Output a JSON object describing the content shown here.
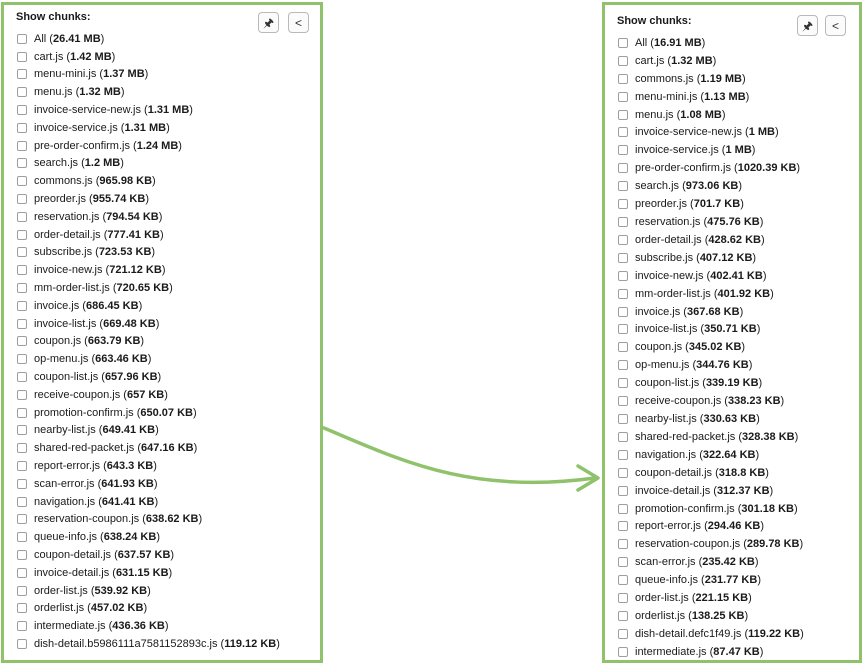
{
  "left_panel": {
    "title": "Show chunks:",
    "pin_icon": "pin-icon",
    "collapse_icon": "chevron-left-icon",
    "items": [
      {
        "name": "All",
        "size": "26.41 MB"
      },
      {
        "name": "cart.js",
        "size": "1.42 MB"
      },
      {
        "name": "menu-mini.js",
        "size": "1.37 MB"
      },
      {
        "name": "menu.js",
        "size": "1.32 MB"
      },
      {
        "name": "invoice-service-new.js",
        "size": "1.31 MB"
      },
      {
        "name": "invoice-service.js",
        "size": "1.31 MB"
      },
      {
        "name": "pre-order-confirm.js",
        "size": "1.24 MB"
      },
      {
        "name": "search.js",
        "size": "1.2 MB"
      },
      {
        "name": "commons.js",
        "size": "965.98 KB"
      },
      {
        "name": "preorder.js",
        "size": "955.74 KB"
      },
      {
        "name": "reservation.js",
        "size": "794.54 KB"
      },
      {
        "name": "order-detail.js",
        "size": "777.41 KB"
      },
      {
        "name": "subscribe.js",
        "size": "723.53 KB"
      },
      {
        "name": "invoice-new.js",
        "size": "721.12 KB"
      },
      {
        "name": "mm-order-list.js",
        "size": "720.65 KB"
      },
      {
        "name": "invoice.js",
        "size": "686.45 KB"
      },
      {
        "name": "invoice-list.js",
        "size": "669.48 KB"
      },
      {
        "name": "coupon.js",
        "size": "663.79 KB"
      },
      {
        "name": "op-menu.js",
        "size": "663.46 KB"
      },
      {
        "name": "coupon-list.js",
        "size": "657.96 KB"
      },
      {
        "name": "receive-coupon.js",
        "size": "657 KB"
      },
      {
        "name": "promotion-confirm.js",
        "size": "650.07 KB"
      },
      {
        "name": "nearby-list.js",
        "size": "649.41 KB"
      },
      {
        "name": "shared-red-packet.js",
        "size": "647.16 KB"
      },
      {
        "name": "report-error.js",
        "size": "643.3 KB"
      },
      {
        "name": "scan-error.js",
        "size": "641.93 KB"
      },
      {
        "name": "navigation.js",
        "size": "641.41 KB"
      },
      {
        "name": "reservation-coupon.js",
        "size": "638.62 KB"
      },
      {
        "name": "queue-info.js",
        "size": "638.24 KB"
      },
      {
        "name": "coupon-detail.js",
        "size": "637.57 KB"
      },
      {
        "name": "invoice-detail.js",
        "size": "631.15 KB"
      },
      {
        "name": "order-list.js",
        "size": "539.92 KB"
      },
      {
        "name": "orderlist.js",
        "size": "457.02 KB"
      },
      {
        "name": "intermediate.js",
        "size": "436.36 KB"
      },
      {
        "name": "dish-detail.b5986111a7581152893c.js",
        "size": "119.12 KB"
      }
    ]
  },
  "right_panel": {
    "title": "Show chunks:",
    "pin_icon": "pin-icon",
    "collapse_icon": "chevron-left-icon",
    "items": [
      {
        "name": "All",
        "size": "16.91 MB"
      },
      {
        "name": "cart.js",
        "size": "1.32 MB"
      },
      {
        "name": "commons.js",
        "size": "1.19 MB"
      },
      {
        "name": "menu-mini.js",
        "size": "1.13 MB"
      },
      {
        "name": "menu.js",
        "size": "1.08 MB"
      },
      {
        "name": "invoice-service-new.js",
        "size": "1 MB"
      },
      {
        "name": "invoice-service.js",
        "size": "1 MB"
      },
      {
        "name": "pre-order-confirm.js",
        "size": "1020.39 KB"
      },
      {
        "name": "search.js",
        "size": "973.06 KB"
      },
      {
        "name": "preorder.js",
        "size": "701.7 KB"
      },
      {
        "name": "reservation.js",
        "size": "475.76 KB"
      },
      {
        "name": "order-detail.js",
        "size": "428.62 KB"
      },
      {
        "name": "subscribe.js",
        "size": "407.12 KB"
      },
      {
        "name": "invoice-new.js",
        "size": "402.41 KB"
      },
      {
        "name": "mm-order-list.js",
        "size": "401.92 KB"
      },
      {
        "name": "invoice.js",
        "size": "367.68 KB"
      },
      {
        "name": "invoice-list.js",
        "size": "350.71 KB"
      },
      {
        "name": "coupon.js",
        "size": "345.02 KB"
      },
      {
        "name": "op-menu.js",
        "size": "344.76 KB"
      },
      {
        "name": "coupon-list.js",
        "size": "339.19 KB"
      },
      {
        "name": "receive-coupon.js",
        "size": "338.23 KB"
      },
      {
        "name": "nearby-list.js",
        "size": "330.63 KB"
      },
      {
        "name": "shared-red-packet.js",
        "size": "328.38 KB"
      },
      {
        "name": "navigation.js",
        "size": "322.64 KB"
      },
      {
        "name": "coupon-detail.js",
        "size": "318.8 KB"
      },
      {
        "name": "invoice-detail.js",
        "size": "312.37 KB"
      },
      {
        "name": "promotion-confirm.js",
        "size": "301.18 KB"
      },
      {
        "name": "report-error.js",
        "size": "294.46 KB"
      },
      {
        "name": "reservation-coupon.js",
        "size": "289.78 KB"
      },
      {
        "name": "scan-error.js",
        "size": "235.42 KB"
      },
      {
        "name": "queue-info.js",
        "size": "231.77 KB"
      },
      {
        "name": "order-list.js",
        "size": "221.15 KB"
      },
      {
        "name": "orderlist.js",
        "size": "138.25 KB"
      },
      {
        "name": "dish-detail.defc1f49.js",
        "size": "119.22 KB"
      },
      {
        "name": "intermediate.js",
        "size": "87.47 KB"
      }
    ]
  },
  "connector": {
    "icon": "curved-arrow-icon",
    "color": "#8fc26b"
  }
}
